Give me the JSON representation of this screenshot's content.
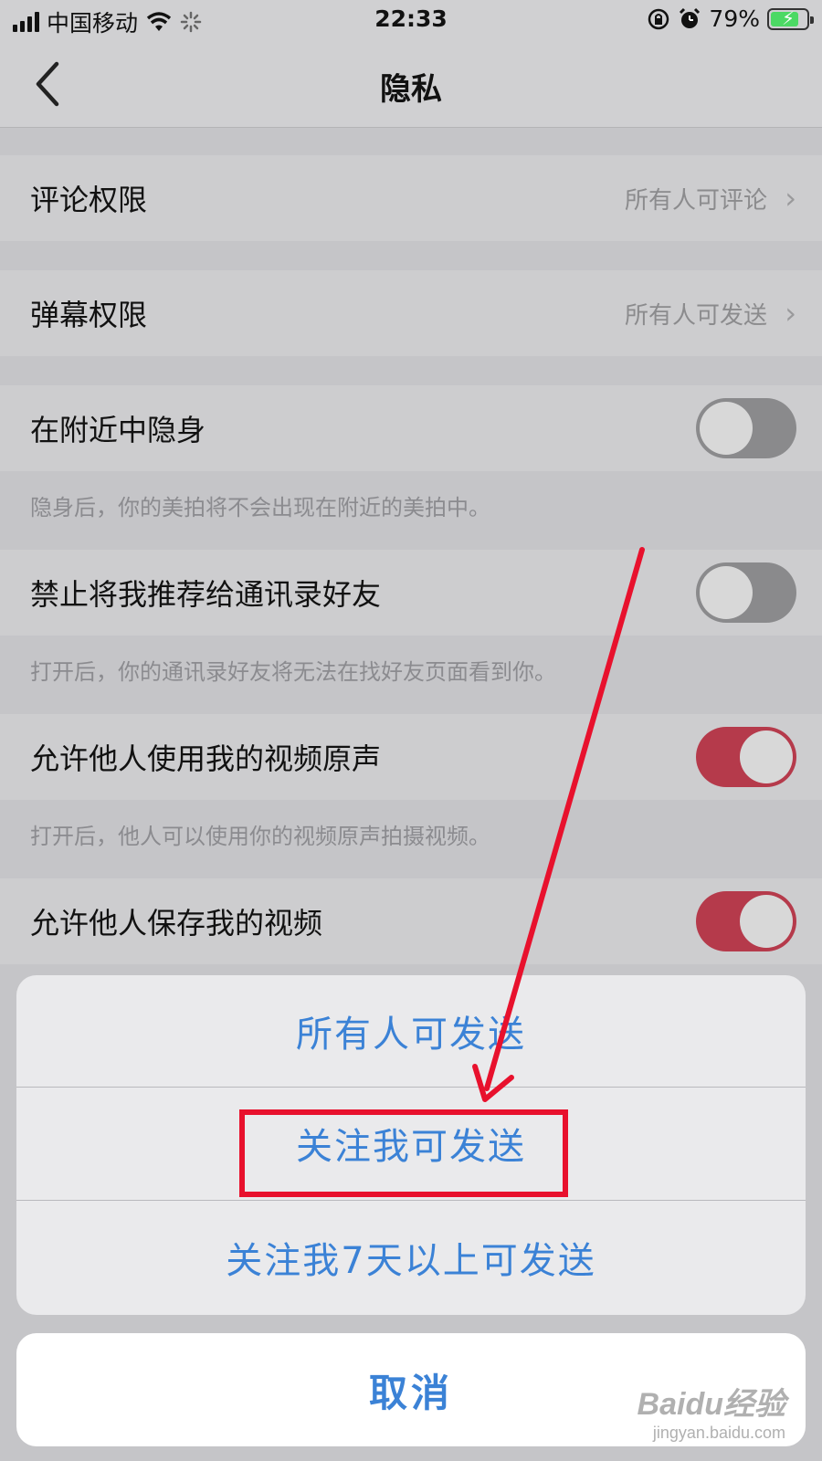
{
  "status_bar": {
    "carrier": "中国移动",
    "time": "22:33",
    "battery_percent": "79%",
    "battery_level": 0.79,
    "battery_color": "#4cd964"
  },
  "nav": {
    "back_icon": "chevron-left-icon",
    "title": "隐私"
  },
  "settings": {
    "comment_permission": {
      "label": "评论权限",
      "value": "所有人可评论"
    },
    "danmaku_permission": {
      "label": "弹幕权限",
      "value": "所有人可发送"
    },
    "hide_nearby": {
      "label": "在附近中隐身",
      "hint": "隐身后，你的美拍将不会出现在附近的美拍中。",
      "on": false
    },
    "block_contacts": {
      "label": "禁止将我推荐给通讯录好友",
      "hint": "打开后，你的通讯录好友将无法在找好友页面看到你。",
      "on": false
    },
    "allow_audio": {
      "label": "允许他人使用我的视频原声",
      "hint": "打开后，他人可以使用你的视频原声拍摄视频。",
      "on": true
    },
    "allow_save": {
      "label": "允许他人保存我的视频",
      "on": true
    }
  },
  "action_sheet": {
    "options": [
      "所有人可发送",
      "关注我可发送",
      "关注我7天以上可发送"
    ],
    "highlighted_option": "关注我可发送",
    "cancel_label": "取消"
  },
  "colors": {
    "accent": "#3b82d6",
    "toggle_on": "#b53a4b",
    "annotation_red": "#e8112d"
  },
  "watermark": {
    "logo": "Baidu经验",
    "url": "jingyan.baidu.com"
  }
}
